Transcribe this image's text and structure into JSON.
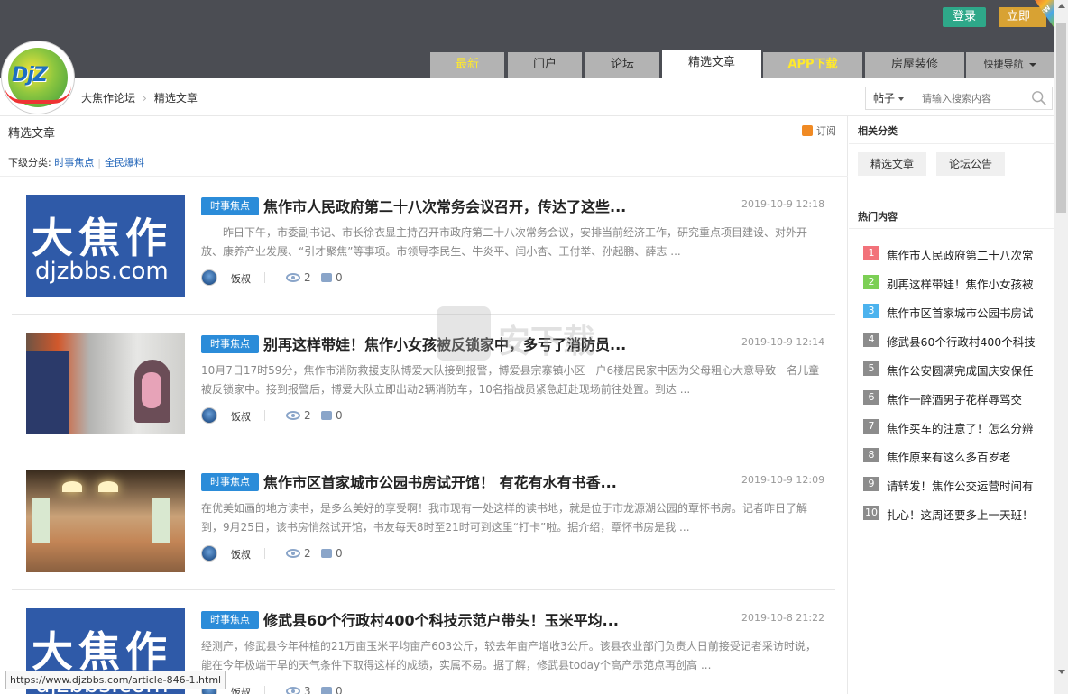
{
  "header": {
    "login_label": "登录",
    "register_label": "立即",
    "new_badge": "NEW",
    "logo_text": "DjZ",
    "nav": [
      {
        "label": "最新"
      },
      {
        "label": "门户"
      },
      {
        "label": "论坛"
      },
      {
        "label": "精选文章"
      },
      {
        "label": "APP下载"
      },
      {
        "label": "房屋装修"
      },
      {
        "label": "快捷导航"
      }
    ]
  },
  "breadcrumb": {
    "items": [
      "大焦作论坛",
      "精选文章"
    ]
  },
  "search": {
    "type": "帖子",
    "placeholder": "请输入搜索内容"
  },
  "main": {
    "section_title": "精选文章",
    "subscribe_label": "订阅",
    "subcat_label": "下级分类:",
    "subcats": [
      "时事焦点",
      "全民爆料"
    ],
    "articles": [
      {
        "tag": "时事焦点",
        "title": "焦作市人民政府第二十八次常务会议召开，传达了这些...",
        "date": "2019-10-9 12:18",
        "summary": "昨日下午，市委副书记、市长徐衣显主持召开市政府第二十八次常务会议，安排当前经济工作，研究重点项目建设、对外开放、康养产业发展、“引才聚焦”等事项。市领导李民生、牛炎平、闫小杏、王付举、孙起鹏、薛志 ...",
        "author": "饭叔",
        "views": "2",
        "replies": "0",
        "thumb_big": "大焦作",
        "thumb_small": "djzbbs.com"
      },
      {
        "tag": "时事焦点",
        "title": "别再这样带娃！焦作小女孩被反锁家中，多亏了消防员...",
        "date": "2019-10-9 12:14",
        "summary": "10月7日17时59分，焦作市消防救援支队博爱大队接到报警，博爱县宗寨镇小区一户6楼居民家中因为父母粗心大意导致一名儿童被反锁家中。接到报警后，博爱大队立即出动2辆消防车，10名指战员紧急赶赴现场前往处置。到达 ...",
        "author": "饭叔",
        "views": "2",
        "replies": "0"
      },
      {
        "tag": "时事焦点",
        "title": "焦作市区首家城市公园书房试开馆！ 有花有水有书香...",
        "date": "2019-10-9 12:09",
        "summary": "在优美如画的地方读书，是多么美好的享受啊！我市现有一处这样的读书地，就是位于市龙源湖公园的覃怀书房。记者昨日了解到，9月25日，该书房悄然试开馆，书友每天8时至21时可到这里“打卡”啦。据介绍，覃怀书房是我 ...",
        "author": "饭叔",
        "views": "2",
        "replies": "0"
      },
      {
        "tag": "时事焦点",
        "title": "修武县60个行政村400个科技示范户带头！玉米平均...",
        "date": "2019-10-8 21:22",
        "summary": "经测产，修武县今年种植的21万亩玉米平均亩产603公斤，较去年亩产增收3公斤。该县农业部门负责人日前接受记者采访时说，能在今年极端干旱的天气条件下取得这样的成绩，实属不易。据了解，修武县today个高产示范点再创高 ...",
        "author": "饭叔",
        "views": "3",
        "replies": "0",
        "thumb_big": "大焦作",
        "thumb_small": "djzbbs.com"
      }
    ]
  },
  "sidebar": {
    "related_title": "相关分类",
    "categories": [
      "精选文章",
      "论坛公告"
    ],
    "hot_title": "热门内容",
    "hot_items": [
      {
        "num": "1",
        "text": "焦作市人民政府第二十八次常",
        "color": "#f2727a"
      },
      {
        "num": "2",
        "text": "别再这样带娃！焦作小女孩被",
        "color": "#7ccf55"
      },
      {
        "num": "3",
        "text": "焦作市区首家城市公园书房试",
        "color": "#4cb3ee"
      },
      {
        "num": "4",
        "text": "修武县60个行政村400个科技",
        "color": "#8c8c8c"
      },
      {
        "num": "5",
        "text": "焦作公安圆满完成国庆安保任",
        "color": "#8c8c8c"
      },
      {
        "num": "6",
        "text": "焦作一醉酒男子花样辱骂交",
        "color": "#8c8c8c"
      },
      {
        "num": "7",
        "text": "焦作买车的注意了！怎么分辨",
        "color": "#8c8c8c"
      },
      {
        "num": "8",
        "text": "焦作原来有这么多百岁老",
        "color": "#8c8c8c"
      },
      {
        "num": "9",
        "text": "请转发！焦作公交运营时间有",
        "color": "#8c8c8c"
      },
      {
        "num": "10",
        "text": "扎心！这周还要多上一天班！",
        "color": "#8c8c8c"
      }
    ]
  },
  "status_url": "https://www.djzbbs.com/article-846-1.html",
  "watermark_text": "安下载"
}
